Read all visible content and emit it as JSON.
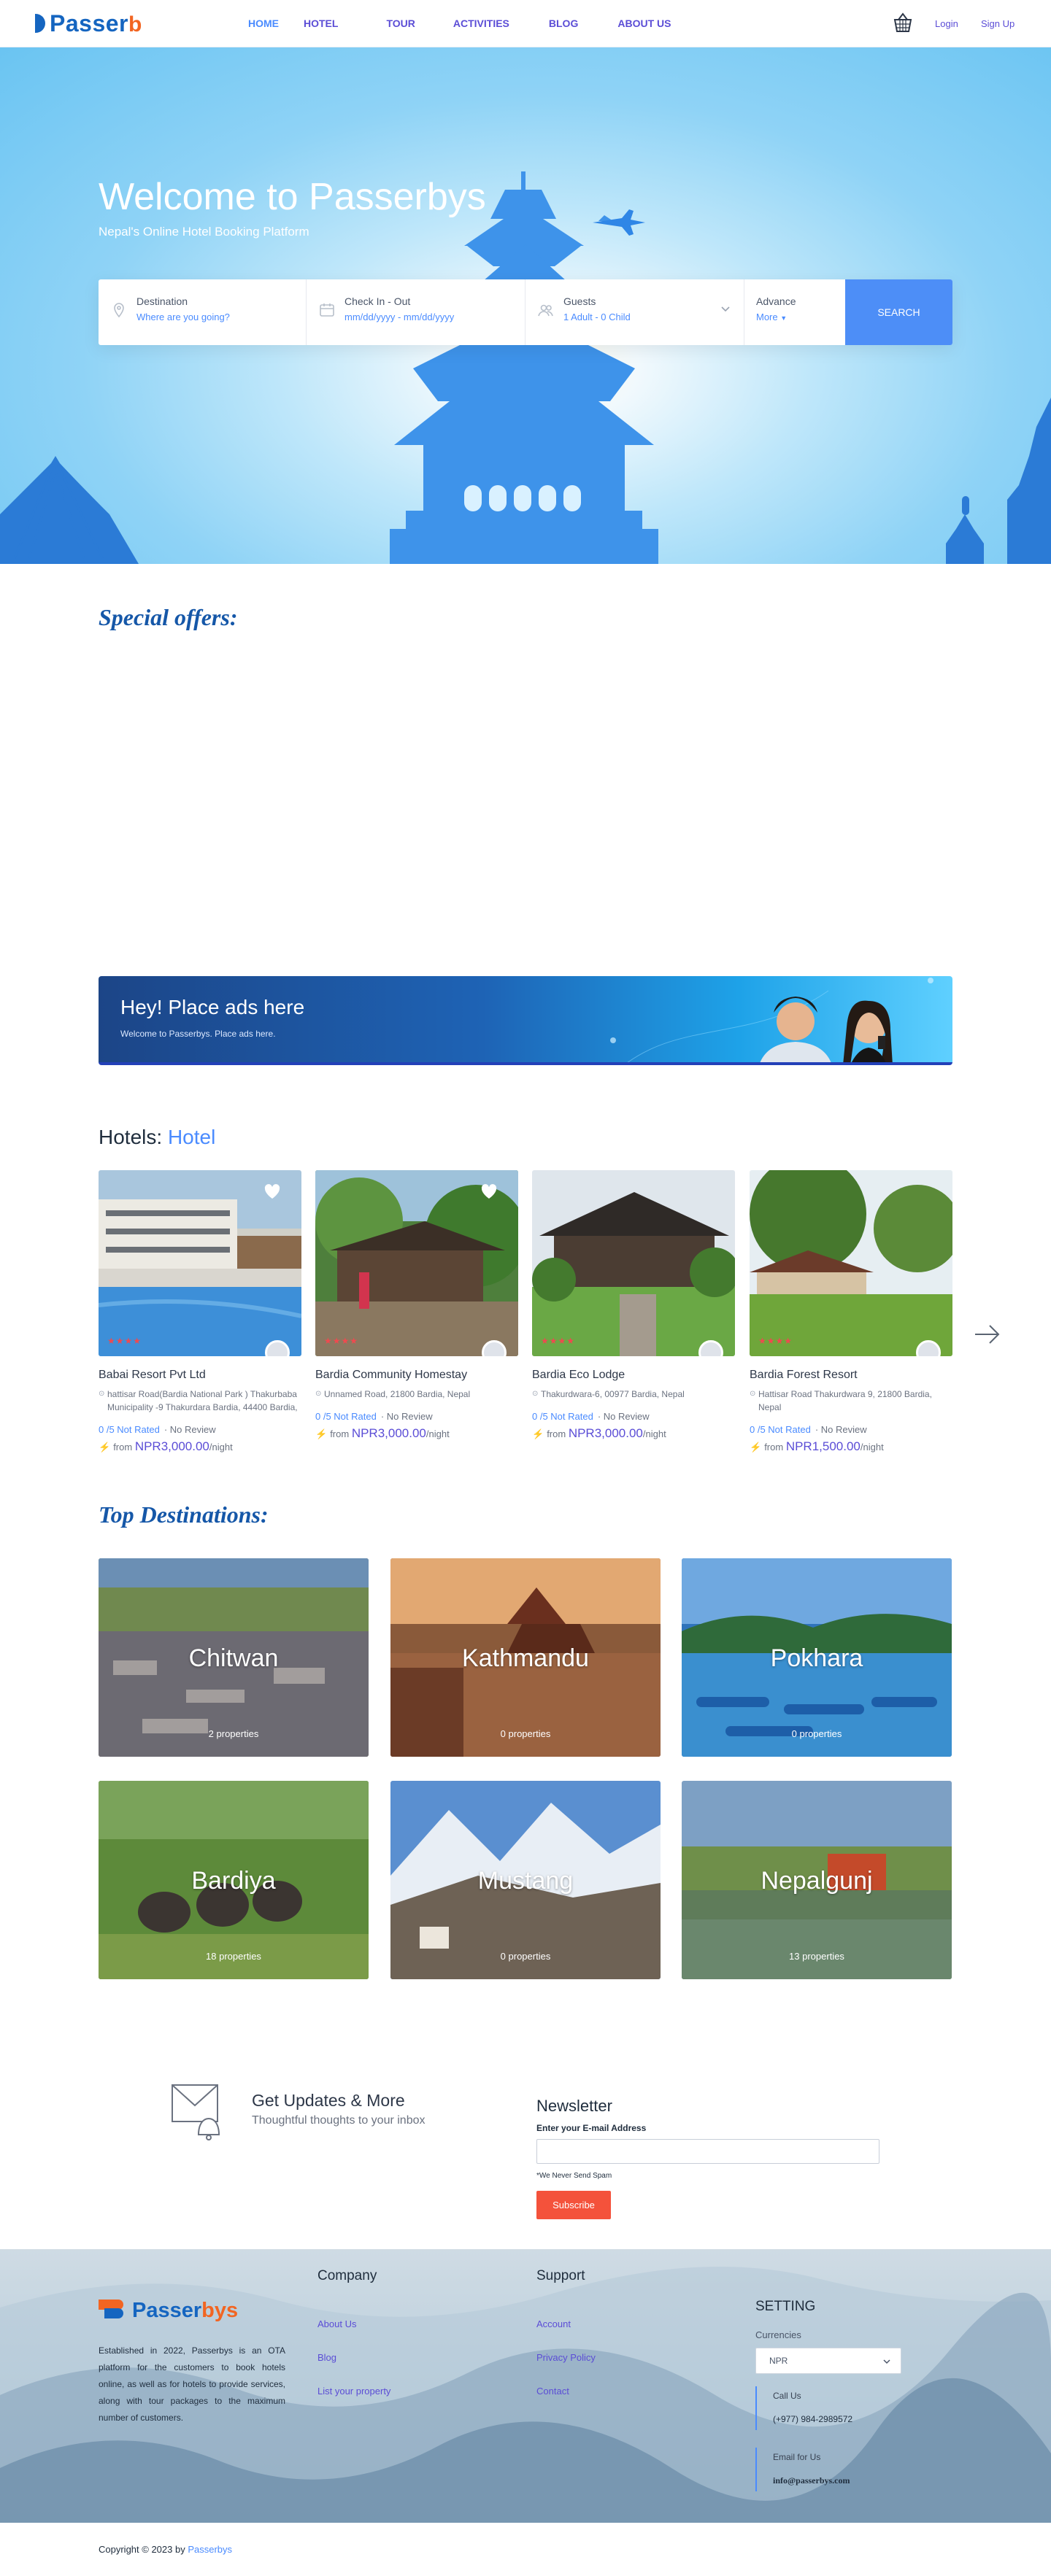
{
  "brand": {
    "name_main": "Passer",
    "name_tail": "b"
  },
  "nav": [
    "HOME",
    "HOTEL",
    "TOUR",
    "ACTIVITIES",
    "BLOG",
    "ABOUT US"
  ],
  "auth": {
    "login": "Login",
    "signup": "Sign Up"
  },
  "hero": {
    "title": "Welcome to Passerbys",
    "subtitle": "Nepal's Online Hotel Booking Platform"
  },
  "search": {
    "destination": {
      "label": "Destination",
      "value": "Where are you going?"
    },
    "dates": {
      "label": "Check In - Out",
      "value": "mm/dd/yyyy - mm/dd/yyyy"
    },
    "guests": {
      "label": "Guests",
      "value": "1 Adult - 0 Child"
    },
    "advance": {
      "label": "Advance",
      "value": "More"
    },
    "button": "SEARCH"
  },
  "special": {
    "title": "Special offers:"
  },
  "ad": {
    "title": "Hey! Place ads here",
    "text": "Welcome to Passerbys. Place ads here."
  },
  "hotels": {
    "title_prefix": "Hotels:",
    "title_highlight": "Hotel",
    "items": [
      {
        "name": "Babai Resort Pvt Ltd",
        "address": "hattisar Road(Bardia National Park ) Thakurbaba Municipality -9 Thakurdara Bardia, 44400 Bardia,",
        "rating": "0 /5 Not Rated",
        "reviews": "No Review",
        "from": "from",
        "price": "NPR3,000.00",
        "unit": "/night",
        "stars": "★★★★"
      },
      {
        "name": "Bardia Community Homestay",
        "address": "Unnamed Road, 21800 Bardia, Nepal",
        "rating": "0 /5 Not Rated",
        "reviews": "No Review",
        "from": "from",
        "price": "NPR3,000.00",
        "unit": "/night",
        "stars": "★★★★"
      },
      {
        "name": "Bardia Eco Lodge",
        "address": "Thakurdwara-6, 00977 Bardia, Nepal",
        "rating": "0 /5 Not Rated",
        "reviews": "No Review",
        "from": "from",
        "price": "NPR3,000.00",
        "unit": "/night",
        "stars": "★★★★"
      },
      {
        "name": "Bardia Forest Resort",
        "address": "Hattisar Road Thakurdwara 9, 21800 Bardia, Nepal",
        "rating": "0 /5 Not Rated",
        "reviews": "No Review",
        "from": "from",
        "price": "NPR1,500.00",
        "unit": "/night",
        "stars": "★★★★"
      }
    ]
  },
  "destinations": {
    "title": "Top Destinations:",
    "items": [
      {
        "name": "Chitwan",
        "count": "2 properties"
      },
      {
        "name": "Kathmandu",
        "count": "0 properties"
      },
      {
        "name": "Pokhara",
        "count": "0 properties"
      },
      {
        "name": "Bardiya",
        "count": "18 properties"
      },
      {
        "name": "Mustang",
        "count": "0 properties"
      },
      {
        "name": "Nepalgunj",
        "count": "13 properties"
      }
    ]
  },
  "updates": {
    "title": "Get Updates & More",
    "subtitle": "Thoughtful thoughts to your inbox"
  },
  "newsletter": {
    "title": "Newsletter",
    "label": "Enter your E-mail Address",
    "note": "*We Never Send Spam",
    "button": "Subscribe"
  },
  "footer": {
    "logo_main": "Passer",
    "logo_tail": "bys",
    "description": "Established in 2022, Passerbys is an OTA platform for the customers to book hotels online, as well as for hotels to provide services, along with tour packages to the maximum number of customers.",
    "company": {
      "title": "Company",
      "links": [
        "About Us",
        "Blog",
        "List your property"
      ]
    },
    "support": {
      "title": "Support",
      "links": [
        "Account",
        "Privacy Policy",
        "Contact"
      ]
    },
    "setting": {
      "title": "SETTING",
      "currencies_label": "Currencies",
      "currency": "NPR",
      "call_label": "Call Us",
      "phone": "(+977) 984-2989572",
      "email_label": "Email for Us",
      "email": "info@passerbys.com"
    }
  },
  "copyright": {
    "text": "Copyright © 2023 by",
    "brand": "Passerbys"
  }
}
